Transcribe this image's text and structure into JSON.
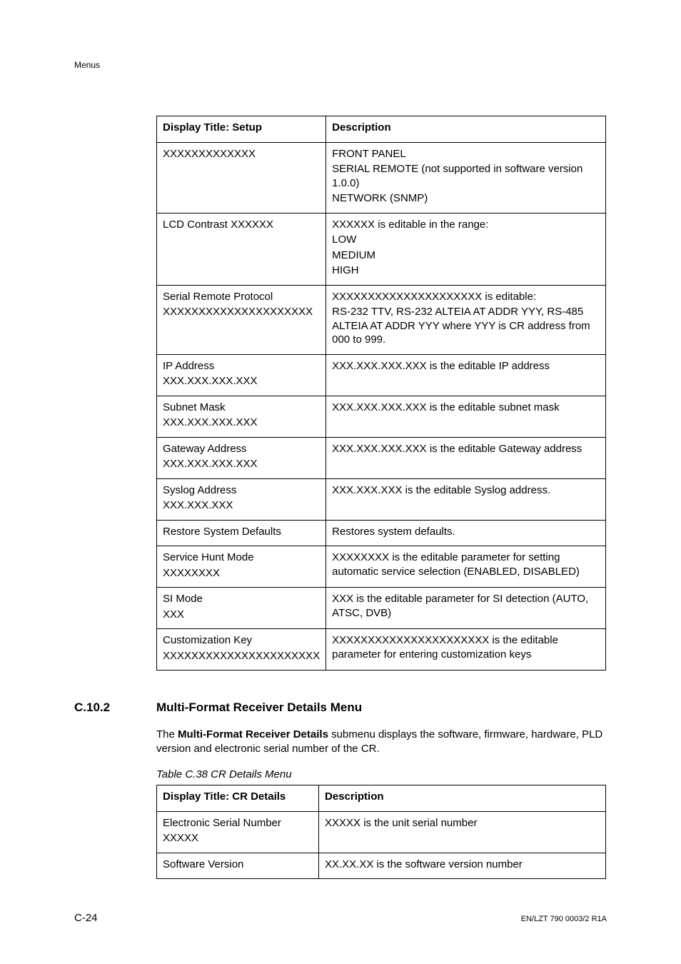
{
  "header": {
    "breadcrumb": "Menus"
  },
  "table1": {
    "headers": {
      "col1": "Display Title: Setup",
      "col2": "Description"
    },
    "rows": [
      {
        "col1_lines": [
          "XXXXXXXXXXXXX"
        ],
        "col2_lines": [
          "FRONT PANEL",
          "SERIAL REMOTE (not supported in software version 1.0.0)",
          "NETWORK (SNMP)"
        ]
      },
      {
        "col1_lines": [
          "LCD Contrast XXXXXX"
        ],
        "col2_lines": [
          "XXXXXX is editable in the range:",
          "LOW",
          "MEDIUM",
          "HIGH"
        ]
      },
      {
        "col1_lines": [
          "Serial Remote Protocol",
          "XXXXXXXXXXXXXXXXXXXXX"
        ],
        "col2_lines": [
          "XXXXXXXXXXXXXXXXXXXXX is editable:",
          "RS-232 TTV, RS-232 ALTEIA AT ADDR YYY, RS-485 ALTEIA AT ADDR YYY where YYY is CR address from 000 to 999."
        ]
      },
      {
        "col1_lines": [
          "IP Address",
          "XXX.XXX.XXX.XXX"
        ],
        "col2_lines": [
          "XXX.XXX.XXX.XXX is the editable IP address"
        ]
      },
      {
        "col1_lines": [
          "Subnet Mask",
          "XXX.XXX.XXX.XXX"
        ],
        "col2_lines": [
          "XXX.XXX.XXX.XXX is the editable subnet mask"
        ]
      },
      {
        "col1_lines": [
          "Gateway Address",
          "XXX.XXX.XXX.XXX"
        ],
        "col2_lines": [
          "XXX.XXX.XXX.XXX is the editable Gateway  address"
        ]
      },
      {
        "col1_lines": [
          "Syslog Address",
          "XXX.XXX.XXX"
        ],
        "col2_lines": [
          "XXX.XXX.XXX is the editable Syslog address."
        ]
      },
      {
        "col1_lines": [
          "Restore System Defaults"
        ],
        "col2_lines": [
          "Restores system defaults."
        ]
      },
      {
        "col1_lines": [
          "Service Hunt Mode",
          "XXXXXXXX"
        ],
        "col2_lines": [
          "XXXXXXXX is the editable parameter for setting automatic service selection (ENABLED, DISABLED)"
        ]
      },
      {
        "col1_lines": [
          "SI Mode",
          "XXX"
        ],
        "col2_lines": [
          "XXX is the editable parameter for SI detection (AUTO, ATSC, DVB)"
        ]
      },
      {
        "col1_lines": [
          "Customization Key",
          "XXXXXXXXXXXXXXXXXXXXXX"
        ],
        "col2_lines": [
          "XXXXXXXXXXXXXXXXXXXXXX is the editable parameter for entering customization keys"
        ]
      }
    ]
  },
  "section": {
    "number": "C.10.2",
    "title": "Multi-Format Receiver Details Menu",
    "intro_prefix": "The ",
    "intro_bold": "Multi-Format Receiver Details",
    "intro_suffix": " submenu displays the software, firmware, hardware, PLD version and electronic serial number of the CR.",
    "table_caption": "Table C.38 CR Details Menu"
  },
  "table2": {
    "headers": {
      "col1": "Display Title: CR Details",
      "col2": "Description"
    },
    "rows": [
      {
        "col1_lines": [
          "Electronic Serial Number",
          "XXXXX"
        ],
        "col2_lines": [
          "XXXXX is the unit serial number"
        ]
      },
      {
        "col1_lines": [
          "Software Version"
        ],
        "col2_lines": [
          "XX.XX.XX is the software version number"
        ]
      }
    ]
  },
  "footer": {
    "left": "C-24",
    "right": "EN/LZT 790 0003/2 R1A"
  }
}
